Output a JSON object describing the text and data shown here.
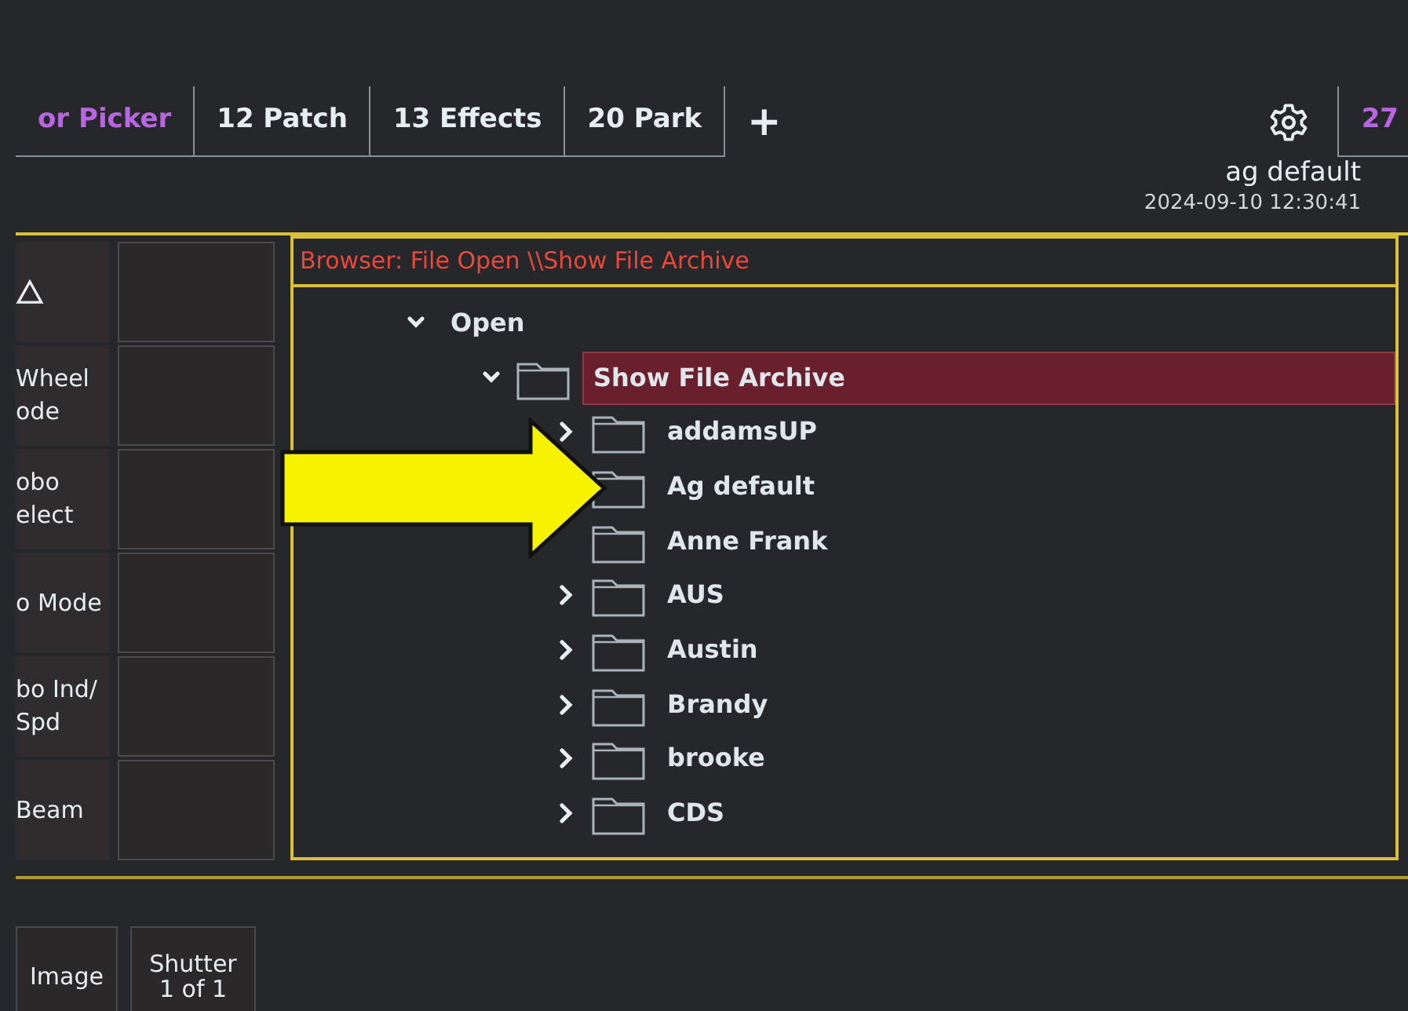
{
  "tabs": [
    {
      "label": "or Picker",
      "color": "#b866e0"
    },
    {
      "label": "12 Patch",
      "color": "#e6eef2"
    },
    {
      "label": "13 Effects",
      "color": "#e6eef2"
    },
    {
      "label": "20 Park",
      "color": "#e6eef2"
    }
  ],
  "add_tab": "+",
  "right_tab": {
    "label": "27",
    "color": "#b866e0"
  },
  "header": {
    "show_name": "ag default",
    "timestamp": "2024-09-10 12:30:41"
  },
  "side_buttons": [
    {
      "kind": "icon"
    },
    {
      "lines": [
        "Wheel",
        "ode"
      ]
    },
    {
      "lines": [
        "obo",
        "elect"
      ]
    },
    {
      "lines": [
        "o Mode"
      ]
    },
    {
      "lines": [
        "bo Ind/",
        "Spd"
      ]
    },
    {
      "lines": [
        "Beam"
      ]
    }
  ],
  "browser": {
    "title": "Browser: File Open \\\\Show File Archive",
    "tree": [
      {
        "label": "Open",
        "expanded": true,
        "selected": false,
        "children": [
          {
            "label": "Show File Archive",
            "expanded": true,
            "selected": true,
            "folder": true,
            "children": [
              {
                "label": "addamsUP",
                "expanded": false,
                "selected": false,
                "folder": true
              },
              {
                "label": "Ag default",
                "selected": false,
                "folder": true
              },
              {
                "label": "Anne Frank",
                "selected": false,
                "folder": true
              },
              {
                "label": "AUS",
                "expanded": false,
                "selected": false,
                "folder": true
              },
              {
                "label": "Austin",
                "expanded": false,
                "selected": false,
                "folder": true
              },
              {
                "label": "Brandy",
                "expanded": false,
                "selected": false,
                "folder": true
              },
              {
                "label": "brooke",
                "expanded": false,
                "selected": false,
                "folder": true
              },
              {
                "label": "CDS",
                "expanded": false,
                "selected": false,
                "folder": true
              }
            ]
          }
        ]
      }
    ]
  },
  "bottom_buttons": [
    {
      "lines": [
        "Image"
      ]
    },
    {
      "lines": [
        "Shutter",
        "1 of 1"
      ]
    }
  ],
  "annotation": {
    "kind": "arrow"
  }
}
